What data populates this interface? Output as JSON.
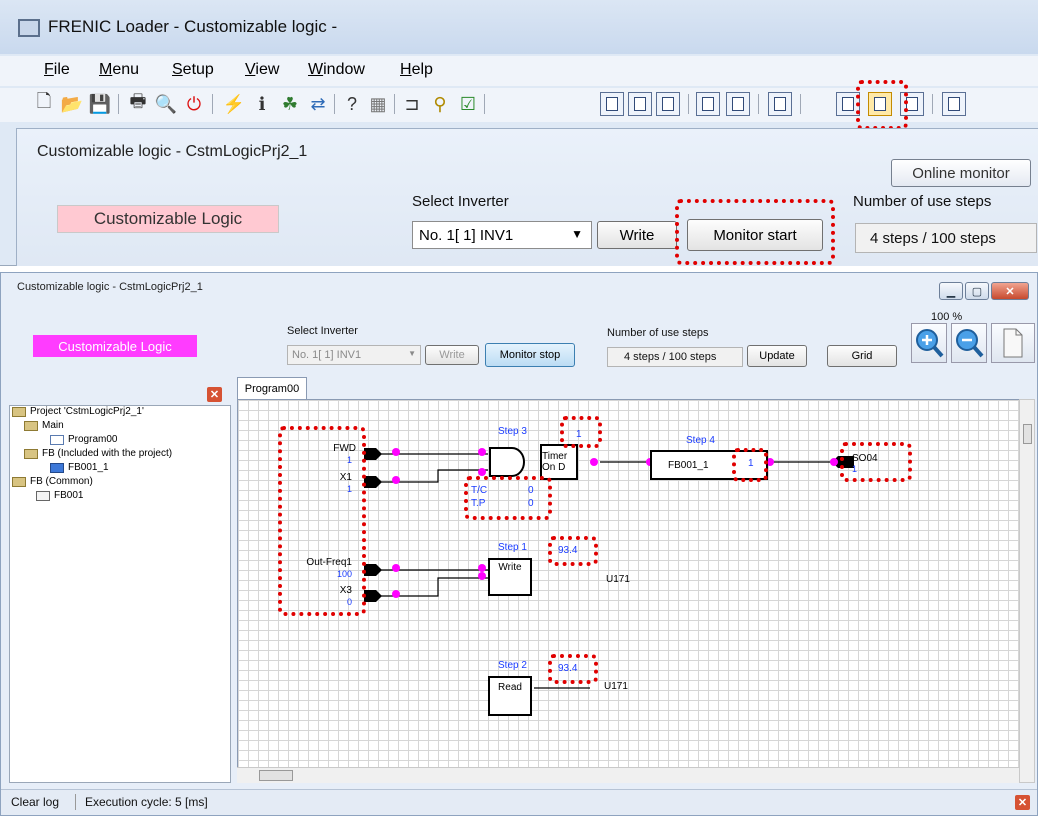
{
  "app": {
    "title": "FRENIC Loader - Customizable logic -",
    "menu": [
      "File",
      "Menu",
      "Setup",
      "View",
      "Window",
      "Help"
    ]
  },
  "top_child": {
    "title": "Customizable logic - CstmLogicPrj2_1",
    "logic_label": "Customizable Logic",
    "select_inverter_label": "Select Inverter",
    "inverter_value": "No. 1[ 1] INV1",
    "write_button": "Write",
    "monitor_button": "Monitor start",
    "steps_label": "Number of use steps",
    "steps_value": "4 steps / 100 steps",
    "tooltip": "Online monitor"
  },
  "window": {
    "title": "Customizable logic - CstmLogicPrj2_1",
    "logic_label": "Customizable Logic",
    "select_inverter_label": "Select Inverter",
    "inverter_value": "No. 1[ 1] INV1",
    "write_button": "Write",
    "monitor_button": "Monitor stop",
    "steps_label": "Number of use steps",
    "steps_value": "4 steps / 100 steps",
    "update_button": "Update",
    "grid_button": "Grid",
    "zoom": "100 %"
  },
  "tree": [
    {
      "label": "Project 'CstmLogicPrj2_1'",
      "icon": "folder"
    },
    {
      "label": "Main",
      "icon": "folder"
    },
    {
      "label": "Program00",
      "icon": "program"
    },
    {
      "label": "FB (Included with the project)",
      "icon": "folder"
    },
    {
      "label": "FB001_1",
      "icon": "fb"
    },
    {
      "label": "FB (Common)",
      "icon": "folder"
    },
    {
      "label": "FB001",
      "icon": "fb-common"
    }
  ],
  "tab": "Program00",
  "diagram": {
    "inputs": [
      {
        "name": "FWD",
        "value": "1"
      },
      {
        "name": "X1",
        "value": "1"
      },
      {
        "name": "Out-Freq1",
        "value": "100"
      },
      {
        "name": "X3",
        "value": "0"
      }
    ],
    "step3": {
      "label": "Step 3",
      "value": "1",
      "block": "Timer On D",
      "tc_label": "T/C",
      "tc": "0",
      "tp_label": "T.P",
      "tp": "0"
    },
    "step4": {
      "label": "Step 4",
      "block": "FB001_1",
      "value": "1",
      "output": "SO04",
      "output_value": "1"
    },
    "step1": {
      "label": "Step 1",
      "value": "93.4",
      "block": "Write",
      "output": "U171"
    },
    "step2": {
      "label": "Step 2",
      "value": "93.4",
      "block": "Read",
      "output": "U171"
    }
  },
  "status": {
    "clear_log": "Clear log",
    "execution_cycle": "Execution cycle:  5  [ms]"
  },
  "colors": {
    "highlight": "#e00000",
    "signal": "#ff00ff",
    "value_text": "#1b3cff",
    "logic_pink": "#ff3cff"
  }
}
